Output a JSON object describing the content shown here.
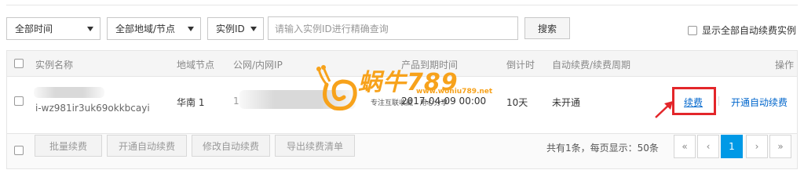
{
  "filters": {
    "time_select": "全部时间",
    "region_select": "全部地域/节点",
    "field_select": "实例ID",
    "search_placeholder": "请输入实例ID进行精确查询",
    "search_button": "搜索",
    "show_all_auto_renew": "显示全部自动续费实例"
  },
  "table": {
    "headers": {
      "name": "实例名称",
      "region": "地域节点",
      "ip": "公网/内网IP",
      "expire": "产品到期时间",
      "countdown": "倒计时",
      "auto_renew": "自动续费/续费周期",
      "actions": "操作"
    },
    "rows": [
      {
        "instance_id": "i-wz981ir3uk69okkbcayi",
        "region": "华南 1",
        "ip_prefix": "1",
        "expire": "2017-04-09 00:00",
        "countdown": "10天",
        "auto_renew": "未开通",
        "action_renew": "续费",
        "action_enable_auto": "开通自动续费"
      }
    ]
  },
  "footer": {
    "batch_renew": "批量续费",
    "enable_auto": "开通自动续费",
    "modify_auto": "修改自动续费",
    "export": "导出续费清单",
    "summary": "共有1条，每页显示：50条",
    "pages": {
      "first": "«",
      "prev": "‹",
      "current": "1",
      "next": "›",
      "last": "»"
    }
  },
  "watermark": {
    "brand": "蜗牛789",
    "url": "www.woniu789.net",
    "slogan": "专注互联收藏 · 用心分享"
  },
  "colors": {
    "link": "#0066cc",
    "highlight": "#e3262a",
    "active_page": "#0099e6",
    "watermark_orange": "#f7a21b"
  }
}
